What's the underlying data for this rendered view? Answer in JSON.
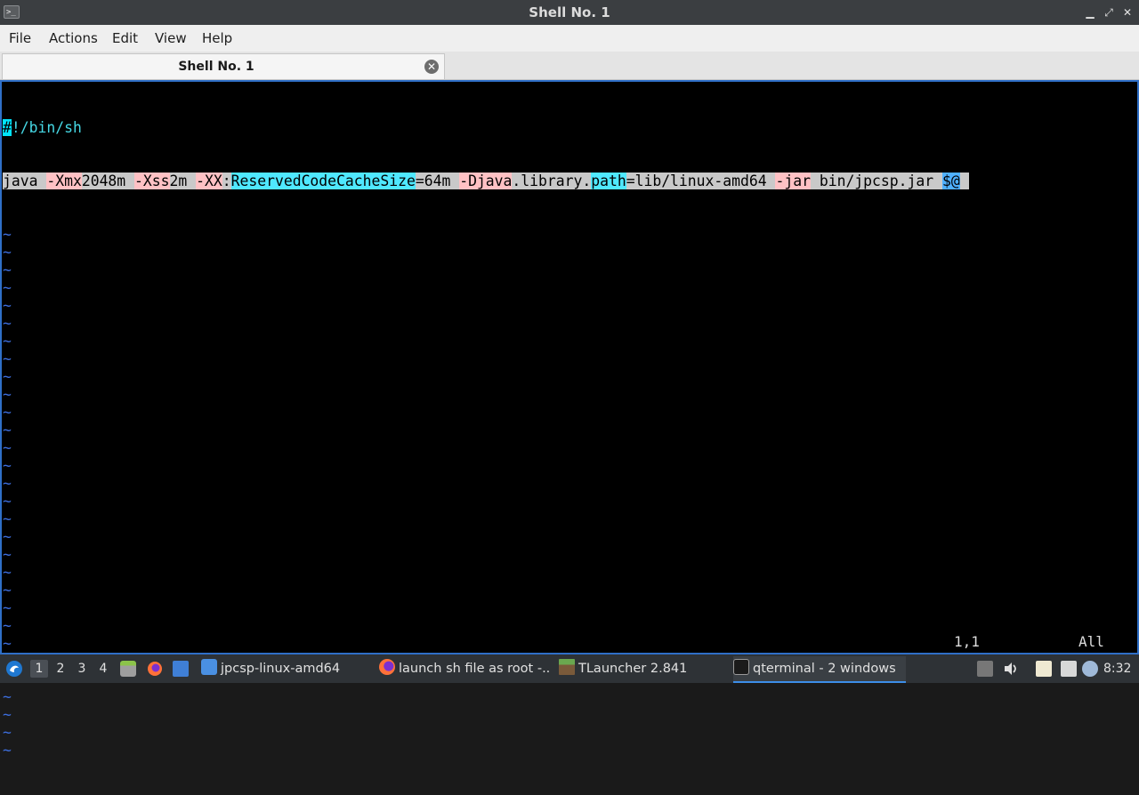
{
  "window": {
    "title": "Shell No. 1",
    "controls": {
      "minimize": "▁",
      "restore": "⤢",
      "close": "✕"
    }
  },
  "menu": [
    "File",
    "Actions",
    "Edit",
    "View",
    "Help"
  ],
  "tab": {
    "label": "Shell No. 1",
    "close_glyph": "✕"
  },
  "editor": {
    "line1": {
      "cursor": "#",
      "rest": "!/bin/sh"
    },
    "line2": {
      "s1": "java ",
      "s2": "-Xmx",
      "s3": "2048m ",
      "s4": "-Xss",
      "s5": "2m ",
      "s6": "-XX",
      "s7": ":",
      "s8": "ReservedCodeCacheSize",
      "s9": "=64m ",
      "s10": "-Djava",
      "s11": ".library.",
      "s12": "path",
      "s13": "=lib/linux-amd64 ",
      "s14": "-jar",
      "s15": " bin/jpcsp.jar ",
      "s16": "$@",
      "s17": " "
    },
    "tilde": "~",
    "position": "1,1",
    "scroll": "All"
  },
  "taskbar": {
    "desktops": [
      "1",
      "2",
      "3",
      "4"
    ],
    "tasks": [
      {
        "label": "jpcsp-linux-amd64",
        "icon": "folder-icon"
      },
      {
        "label": "launch sh file as root -...",
        "icon": "firefox-icon"
      },
      {
        "label": "TLauncher 2.841",
        "icon": "minecraft-block-icon"
      },
      {
        "label": "qterminal - 2 windows",
        "icon": "terminal-icon"
      }
    ],
    "clock": "8:32"
  },
  "colors": {
    "terminal_bg": "#000000",
    "border_accent": "#2f6fc7",
    "tilde": "#3d6fe0",
    "highlight_cyan": "#00e5ff",
    "highlight_pink": "#ffc1c4",
    "line_highlight": "#c9c9c9"
  }
}
